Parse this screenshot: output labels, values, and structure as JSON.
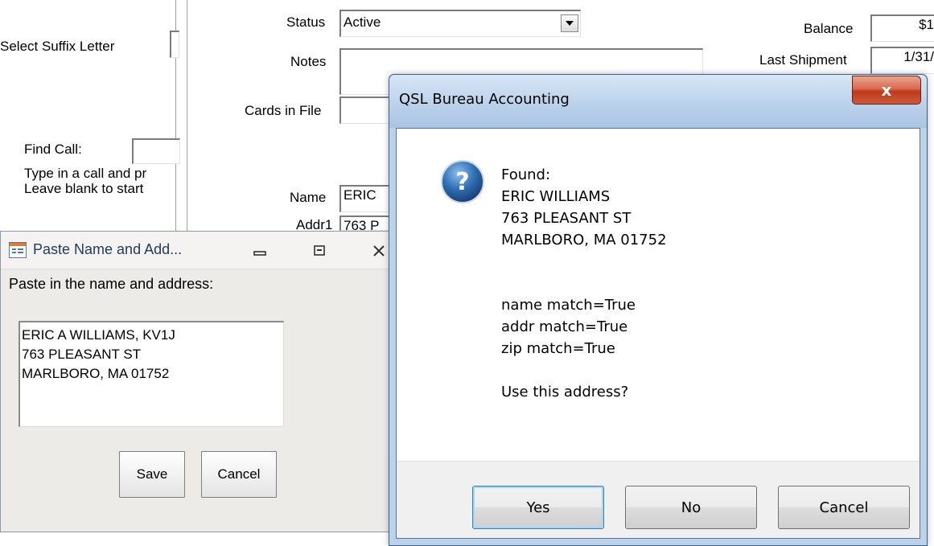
{
  "background_form": {
    "select_suffix_label": "Select Suffix Letter",
    "select_suffix_value": "",
    "find_call_label": "Find Call:",
    "find_call_value": "",
    "help_line_1": "Type in a call and pr",
    "help_line_2": "Leave blank to start",
    "status_label": "Status",
    "status_value": "Active",
    "notes_label": "Notes",
    "notes_value": "",
    "cards_in_file_label": "Cards in File",
    "cards_in_file_value": "",
    "name_label": "Name",
    "name_value": "ERIC",
    "addr1_label": "Addr1",
    "addr1_value": "763 P",
    "balance_label": "Balance",
    "balance_value": "$1",
    "last_shipment_label": "Last Shipment",
    "last_shipment_value": "1/31/"
  },
  "paste_dialog": {
    "title": "Paste Name and Add...",
    "prompt": "Paste in the name and address:",
    "address_lines": [
      "ERIC A WILLIAMS, KV1J",
      "763 PLEASANT ST",
      "MARLBORO, MA 01752"
    ],
    "save_label": "Save",
    "cancel_label": "Cancel"
  },
  "message_box": {
    "title": "QSL Bureau Accounting",
    "close_glyph": "x",
    "found_lines": [
      "Found:",
      "ERIC WILLIAMS",
      "763 PLEASANT ST",
      "MARLBORO, MA 01752"
    ],
    "match_lines": [
      "name match=True",
      "addr match=True",
      "zip match=True"
    ],
    "question": "Use this address?",
    "yes_label": "Yes",
    "no_label": "No",
    "cancel_label": "Cancel",
    "icon": "question-icon",
    "accent_color": "#2f6fb3"
  }
}
